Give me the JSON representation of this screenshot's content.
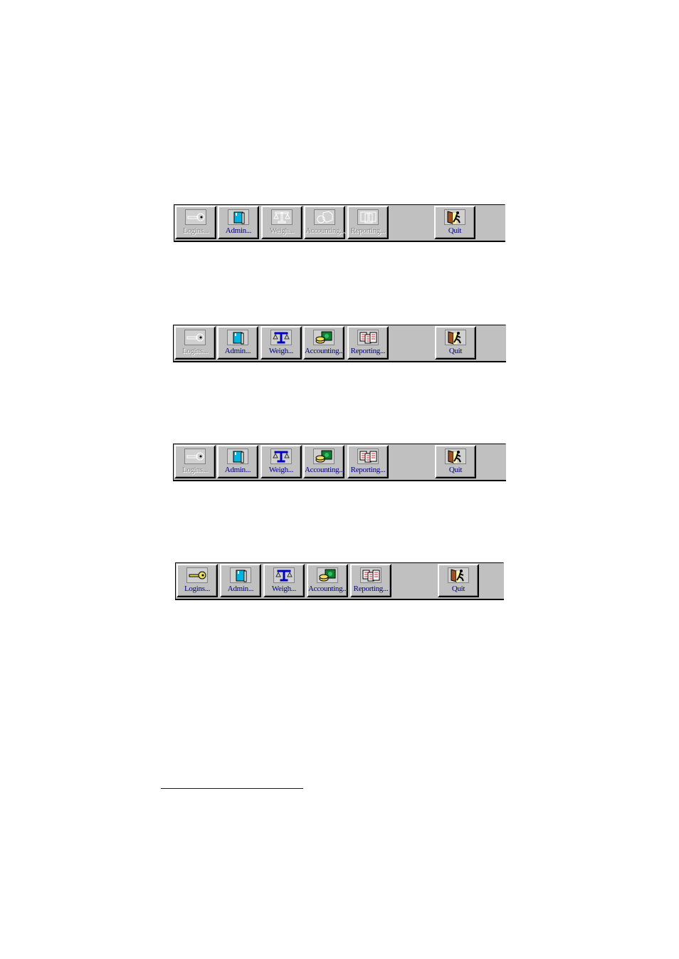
{
  "toolbars": [
    {
      "state": "initial",
      "buttons": [
        {
          "label": "Logins...",
          "icon": "key-icon",
          "enabled": false
        },
        {
          "label": "Admin...",
          "icon": "book-icon",
          "enabled": true
        },
        {
          "label": "Weigh...",
          "icon": "scale-icon",
          "enabled": false
        },
        {
          "label": "Accounting...",
          "icon": "money-icon",
          "enabled": false
        },
        {
          "label": "Reporting...",
          "icon": "report-icon",
          "enabled": false
        },
        {
          "label": "Quit",
          "icon": "exit-door-icon",
          "enabled": true
        }
      ]
    },
    {
      "state": "after-admin",
      "buttons": [
        {
          "label": "Logins...",
          "icon": "key-icon",
          "enabled": false
        },
        {
          "label": "Admin...",
          "icon": "book-icon",
          "enabled": true
        },
        {
          "label": "Weigh...",
          "icon": "scale-icon",
          "enabled": true
        },
        {
          "label": "Accounting...",
          "icon": "money-icon",
          "enabled": true
        },
        {
          "label": "Reporting...",
          "icon": "report-icon",
          "enabled": true
        },
        {
          "label": "Quit",
          "icon": "exit-door-icon",
          "enabled": true
        }
      ]
    },
    {
      "state": "after-admin-2",
      "buttons": [
        {
          "label": "Logins...",
          "icon": "key-icon",
          "enabled": false
        },
        {
          "label": "Admin...",
          "icon": "book-icon",
          "enabled": true
        },
        {
          "label": "Weigh...",
          "icon": "scale-icon",
          "enabled": true
        },
        {
          "label": "Accounting...",
          "icon": "money-icon",
          "enabled": true
        },
        {
          "label": "Reporting...",
          "icon": "report-icon",
          "enabled": true
        },
        {
          "label": "Quit",
          "icon": "exit-door-icon",
          "enabled": true
        }
      ]
    },
    {
      "state": "all-enabled",
      "buttons": [
        {
          "label": "Logins...",
          "icon": "key-icon",
          "enabled": true
        },
        {
          "label": "Admin...",
          "icon": "book-icon",
          "enabled": true
        },
        {
          "label": "Weigh...",
          "icon": "scale-icon",
          "enabled": true
        },
        {
          "label": "Accounting...",
          "icon": "money-icon",
          "enabled": true
        },
        {
          "label": "Reporting...",
          "icon": "report-icon",
          "enabled": true
        },
        {
          "label": "Quit",
          "icon": "exit-door-icon",
          "enabled": true
        }
      ]
    }
  ],
  "colors": {
    "enabled_label": "#000080",
    "disabled_label": "#8a8a8a",
    "toolbar_bg": "#c0c0c0"
  }
}
